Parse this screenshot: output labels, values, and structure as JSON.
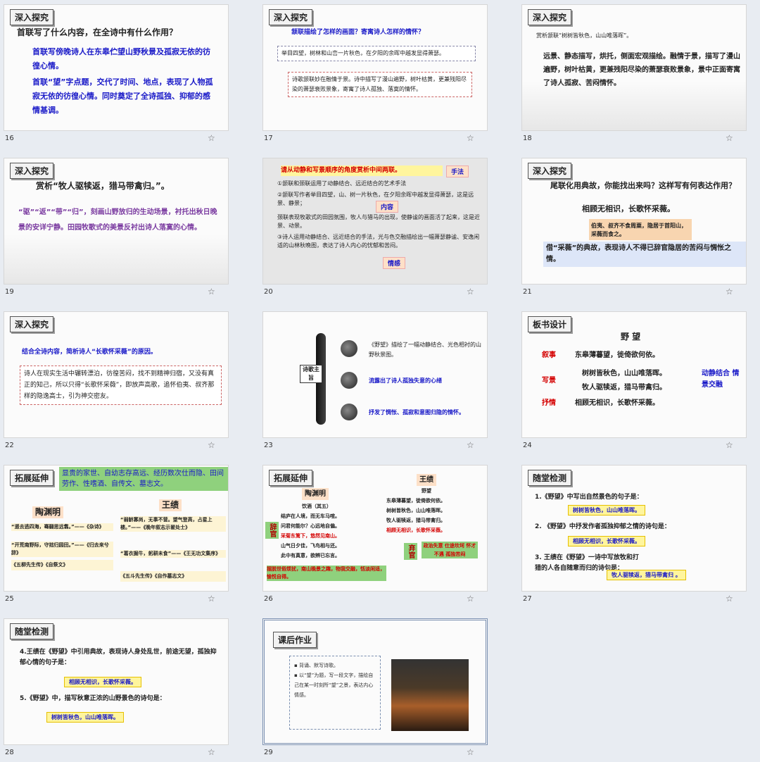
{
  "slides": [
    {
      "num": "16",
      "tag": "深入探究",
      "q": "首联写了什么内容，在全诗中有什么作用？",
      "a1": "首联写傍晚诗人在东皋伫望山野秋景及孤寂无依的彷徨心情。",
      "a2": "首联“望”字点题，交代了时间、地点，表现了人物孤寂无依的彷徨心情。同时奠定了全诗孤独、抑郁的感情基调。"
    },
    {
      "num": "17",
      "tag": "深入探究",
      "q": "颔联描绘了怎样的画面？寄寓诗人怎样的情怀？",
      "a1": "举目四望，树林和山峦一片秋色，在夕阳的余晖中越发显得萧瑟。",
      "a2": "诗歌颔联妙在融情于景。诗中描写了漫山遍野，树叶枯黄，更兼残阳尽染的萧瑟衰败景象，寄寓了诗人孤独、落寞的情怀。"
    },
    {
      "num": "18",
      "tag": "深入探究",
      "q": "赏析颔联“树树皆秋色，山山唯落晖”。",
      "a1": "远景、静态描写，烘托，侧面宏观描绘。融情于景，描写了漫山遍野，树叶枯黄，更兼残阳尽染的萧瑟衰败景象，景中正面寄寓了诗人孤寂、苦闷情怀。"
    },
    {
      "num": "19",
      "tag": "深入探究",
      "q": "赏析“牧人驱犊返，猎马带禽归。”。",
      "a1": "“驱”“返”“带”“归”，刻画山野放归的生动场景，衬托出秋日晚景的安详宁静。田园牧歌式的美景反衬出诗人落寞的心情。"
    },
    {
      "num": "20",
      "head": "请从动静和写景顺序的角度赏析中间两联。",
      "lbl1": "手法",
      "lbl2": "内容",
      "lbl3": "情感",
      "p1": "①颔联和颈联运用了动静结合、远近结合的艺术手法",
      "p2": "②颔联写作者举目四望，山、树一片秋色，在夕阳余晖中越发显得萧瑟，这是远景、静景；",
      "p3": "颈联表现牧歌式的田园氛围，牧人与猎马的出现，使静谧的画面活了起来，这是近景、动景。",
      "p4": "③诗人运用动静结合、远近结合的手法，光与色交融描绘出一幅萧瑟静谧、安逸闲适的山林秋晚图，表达了诗人内心的忧郁和苦闷。"
    },
    {
      "num": "21",
      "tag": "深入探究",
      "q": "尾联化用典故，你能找出来吗？这样写有何表达作用？",
      "line": "相顾无相识，长歌怀采薇。",
      "note": "伯夷、叔齐不食周粟，隐居于首阳山，采薇而食之。",
      "a1": "借“采薇”的典故，表现诗人不得已辞官隐居的苦闷与惆怅之情。"
    },
    {
      "num": "22",
      "tag": "深入探究",
      "q": "结合全诗内容，简析诗人“长歌怀采薇”的原因。",
      "a1": "诗人在现实生活中辗转漂泊，彷徨苦闷，找不到精神归宿，又没有真正的知己，所以只得“长歌怀采薇”，即放声高歌，追怀伯夷、叔齐那样的隐逸高士，引为神交密友。"
    },
    {
      "num": "23",
      "label": "诗歌主旨",
      "r1": "《野望》描绘了一幅动静结合、光色相衬的山野秋景图。",
      "r2": "流露出了诗人孤独失意的心绪",
      "r3": "抒发了惆怅、孤寂和意图归隐的情怀。"
    },
    {
      "num": "24",
      "tag": "板书设计",
      "title": "野 望",
      "rows": [
        [
          "叙事",
          "东皋薄暮望，徙倚欲何依。"
        ],
        [
          "写景",
          "树树皆秋色，山山唯落晖。"
        ],
        [
          "",
          "牧人驱犊返，猎马带禽归。"
        ],
        [
          "抒情",
          "相顾无相识，长歌怀采薇。"
        ]
      ],
      "side": "动静结合 情景交融"
    },
    {
      "num": "25",
      "tag": "拓展延伸",
      "banner": "显贵的家世、自幼志存高远、经历数次仕而隐、田间劳作、性嗜酒、自传文、墓志文。",
      "n1": "陶渊明",
      "n2": "王绩",
      "q1": "“遥去逃四海，骞翮思远翥。”——《杂诗》",
      "q2": "“开荒南野际，守拙归园田。”——《归去来兮辞》",
      "q3": "《五柳先生传》《自祭文》",
      "q4": "“弱龄寡尚，无事不营。望气登高，占星上楼。”——《晚年叙志示翟处士》",
      "q5": "“葛衣掘牛，躬耕未食”——《王无功文集序》",
      "q6": "《五斗先生传》《自作墓志文》"
    },
    {
      "num": "26",
      "tag": "拓展延伸",
      "n1": "陶渊明",
      "n2": "王绩",
      "poem1": [
        "饮酒（其五）",
        "结庐在人境，而无车马喧。",
        "问君何能尔？心远地自偏。",
        "采菊东篱下，悠然见南山。",
        "山气日夕佳，飞鸟相与还。",
        "此中有真意，欲辨已忘言。"
      ],
      "poem2": [
        "野望",
        "东皋薄暮望，徙倚欲何依。",
        "树树皆秋色，山山唯落晖。",
        "牧人驱犊返，猎马带禽归。",
        "相顾无相识，长歌怀采薇。"
      ],
      "s1": "辞官",
      "s2": "弃官",
      "g1": "摆脱世俗烦扰，南山晚景之趣，物我交融，恬淡闲适，愉悦自得。",
      "g2": "政治失意 仕途坎坷 怀才不遇 孤独苦闷"
    },
    {
      "num": "27",
      "tag": "随堂检测",
      "q1": "1.《野望》中写出自然景色的句子是：",
      "a1": "树树皆秋色，山山唯落晖。",
      "q2": "2. 《野望》中抒发作者孤独抑郁之情的诗句是：",
      "a2": "相顾无相识，长歌怀采薇。",
      "q3": "3. 王绩在《野望》一诗中写放牧和打猎的人各自随意而归的诗句是：",
      "a3": "牧人驱犊返，猎马带禽归 。"
    },
    {
      "num": "28",
      "tag": "随堂检测",
      "q1": "4.王绩在《野望》中引用典故，表现诗人身处乱世，前途无望，孤独抑郁心情的句子是：",
      "a1": "相顾无相识，长歌怀采薇。",
      "q2": "5.《野望》中，描写秋意正浓的山野景色的诗句是：",
      "a2": "树树皆秋色，山山唯落晖。"
    },
    {
      "num": "29",
      "tag": "课后作业",
      "h1": "▪ 背诵、默写诗歌。",
      "h2": "▪ 以“望”为题，写一段文字，描绘自己在某一时刻所“望”之景，表达内心情感。"
    }
  ],
  "star": "☆"
}
